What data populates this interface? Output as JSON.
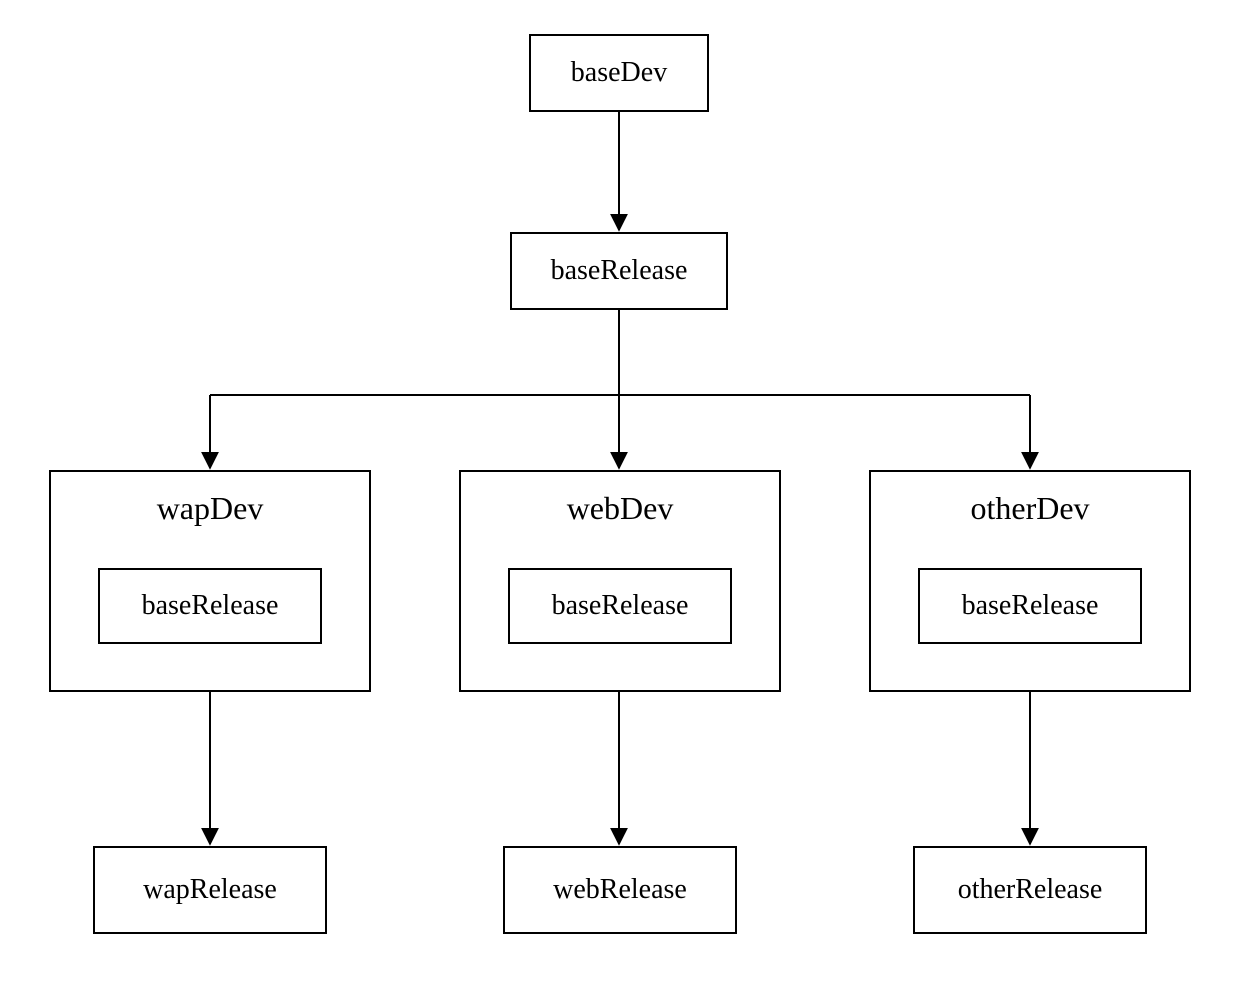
{
  "nodes": {
    "baseDev": "baseDev",
    "baseRelease": "baseRelease"
  },
  "branches": [
    {
      "dev": "wapDev",
      "inner": "baseRelease",
      "release": "wapRelease"
    },
    {
      "dev": "webDev",
      "inner": "baseRelease",
      "release": "webRelease"
    },
    {
      "dev": "otherDev",
      "inner": "baseRelease",
      "release": "otherRelease"
    }
  ]
}
